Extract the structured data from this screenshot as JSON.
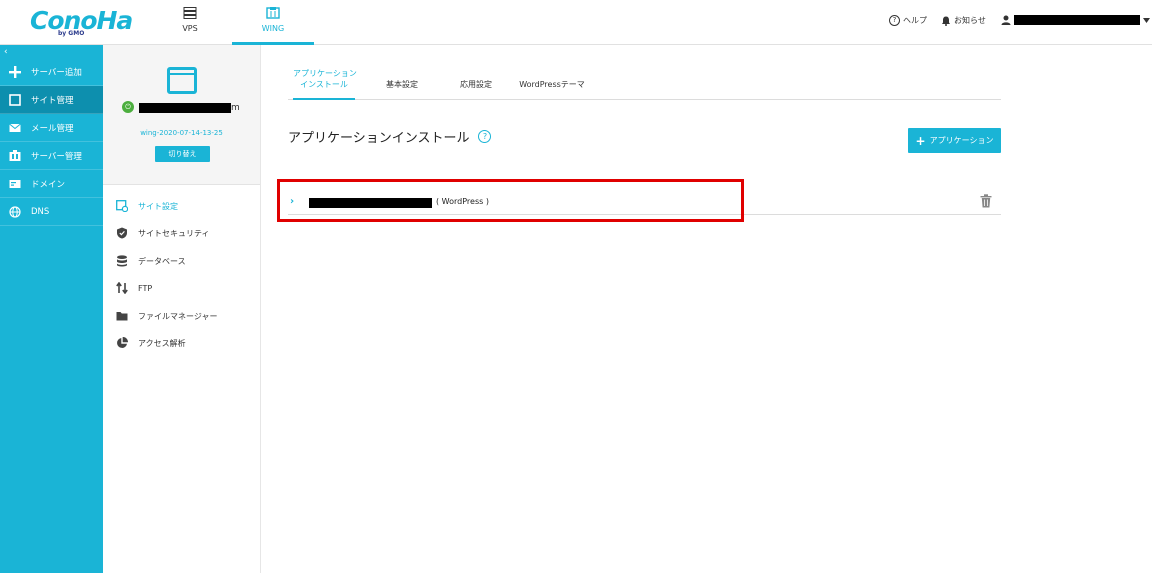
{
  "header": {
    "logo_text": "ConoHa",
    "logo_sub": "by GMO",
    "tabs": [
      {
        "label": "VPS",
        "icon": "server-icon"
      },
      {
        "label": "WING",
        "icon": "wing-icon"
      }
    ],
    "help_label": "ヘルプ",
    "notice_label": "お知らせ"
  },
  "sidebar": {
    "collapse_glyph": "‹",
    "items": [
      {
        "label": "サーバー追加",
        "icon": "plus-icon"
      },
      {
        "label": "サイト管理",
        "icon": "window-icon"
      },
      {
        "label": "メール管理",
        "icon": "mail-icon"
      },
      {
        "label": "サーバー管理",
        "icon": "server-manage-icon"
      },
      {
        "label": "ドメイン",
        "icon": "domain-icon"
      },
      {
        "label": "DNS",
        "icon": "globe-icon"
      }
    ]
  },
  "site_panel": {
    "site_name_suffix": "m",
    "site_id": "wing-2020-07-14-13-25",
    "switch_label": "切り替え",
    "menu": [
      {
        "label": "サイト設定",
        "icon": "site-settings-icon"
      },
      {
        "label": "サイトセキュリティ",
        "icon": "shield-icon"
      },
      {
        "label": "データベース",
        "icon": "database-icon"
      },
      {
        "label": "FTP",
        "icon": "transfer-arrows-icon"
      },
      {
        "label": "ファイルマネージャー",
        "icon": "folder-icon"
      },
      {
        "label": "アクセス解析",
        "icon": "pie-chart-icon"
      }
    ]
  },
  "main": {
    "tabs": [
      {
        "label_line1": "アプリケーション",
        "label_line2": "インストール"
      },
      {
        "label_line1": "基本設定"
      },
      {
        "label_line1": "応用設定"
      },
      {
        "label_line1": "WordPressテーマ"
      }
    ],
    "title": "アプリケーションインストール",
    "help_glyph": "?",
    "add_button_label": "アプリケーション",
    "add_button_glyph": "+",
    "apps": [
      {
        "chevron": "›",
        "type": "( WordPress )"
      }
    ]
  },
  "colors": {
    "accent": "#1ab4d6",
    "sidebar_active": "#0d8fae",
    "highlight": "#e00000"
  }
}
